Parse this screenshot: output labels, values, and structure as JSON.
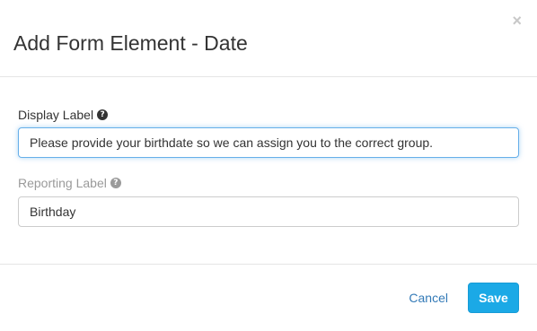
{
  "modal": {
    "title": "Add Form Element - Date",
    "close_label": "×"
  },
  "fields": {
    "display": {
      "label": "Display Label",
      "help_icon": "question-circle-icon",
      "value": "Please provide your birthdate so we can assign you to the correct group."
    },
    "reporting": {
      "label": "Reporting Label",
      "help_icon": "question-circle-icon",
      "value": "Birthday"
    }
  },
  "footer": {
    "cancel_label": "Cancel",
    "save_label": "Save"
  },
  "colors": {
    "primary": "#1ba9e6",
    "link": "#337ab7",
    "focus_border": "#66afe9",
    "muted_label": "#9a9a9a"
  }
}
